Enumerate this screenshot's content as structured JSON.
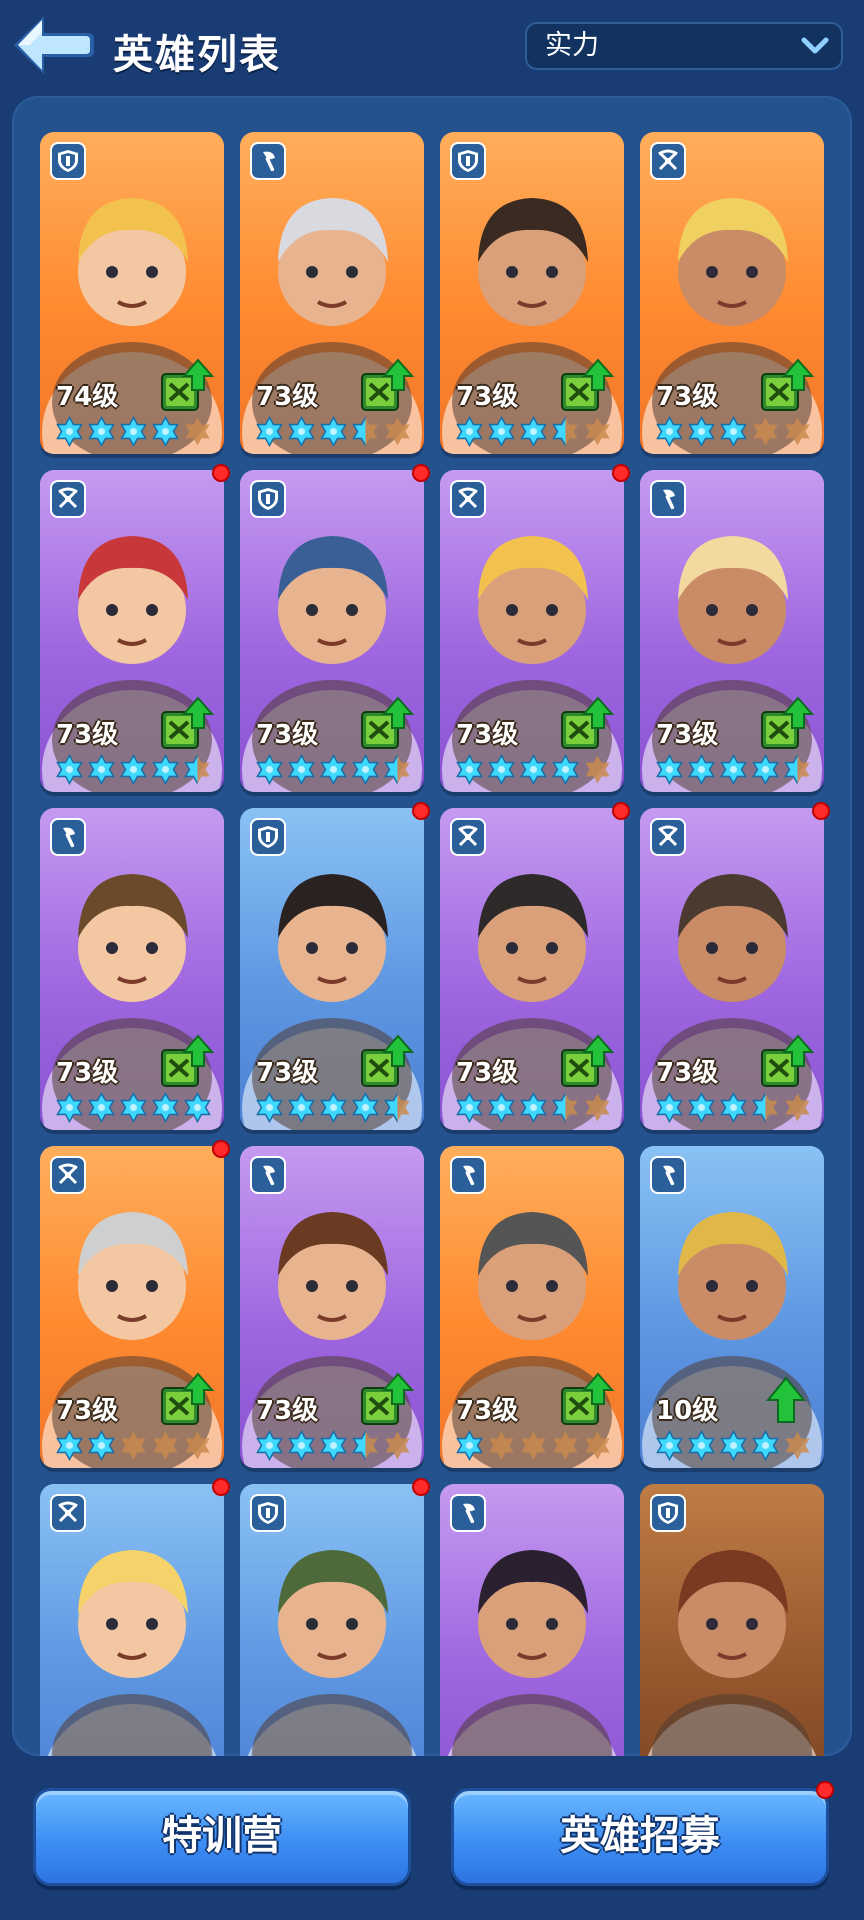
{
  "header": {
    "title": "英雄列表",
    "back_icon": "back-arrow-icon",
    "sort_select": {
      "selected": "实力",
      "icon": "chevron-down-icon"
    }
  },
  "colors": {
    "background": "#183c73",
    "panel": "#23528f",
    "star_filled": "#3fd8ff",
    "star_empty": "#c98a4d",
    "upgrade_arrow": "#22c33b",
    "red_dot": "#ff2a2a"
  },
  "heroes": [
    {
      "level": "74级",
      "rarity": "orange",
      "class_icon": "shield-icon",
      "stars": 4,
      "half": false,
      "dot": false,
      "upgrade": "book-upgrade-icon",
      "portrait": "girl-blonde-pigtails"
    },
    {
      "level": "73级",
      "rarity": "orange",
      "class_icon": "axe-icon",
      "stars": 3,
      "half": true,
      "dot": false,
      "upgrade": "book-upgrade-icon",
      "portrait": "girl-silver-hair-goggles"
    },
    {
      "level": "73级",
      "rarity": "orange",
      "class_icon": "shield-icon",
      "stars": 3,
      "half": true,
      "dot": false,
      "upgrade": "book-upgrade-icon",
      "portrait": "welder-mask-man"
    },
    {
      "level": "73级",
      "rarity": "orange",
      "class_icon": "crossbow-icon",
      "stars": 3,
      "half": false,
      "dot": false,
      "upgrade": "book-upgrade-icon",
      "portrait": "miner-helmet-old-man"
    },
    {
      "level": "73级",
      "rarity": "purple",
      "class_icon": "crossbow-icon",
      "stars": 4,
      "half": true,
      "dot": true,
      "upgrade": "book-upgrade-icon",
      "portrait": "red-haired-girl"
    },
    {
      "level": "73级",
      "rarity": "purple",
      "class_icon": "shield-icon",
      "stars": 4,
      "half": true,
      "dot": true,
      "upgrade": "book-upgrade-icon",
      "portrait": "officer-helmet-man"
    },
    {
      "level": "73级",
      "rarity": "purple",
      "class_icon": "crossbow-icon",
      "stars": 4,
      "half": false,
      "dot": true,
      "upgrade": "book-upgrade-icon",
      "portrait": "pilot-goggles-man"
    },
    {
      "level": "73级",
      "rarity": "purple",
      "class_icon": "axe-icon",
      "stars": 4,
      "half": true,
      "dot": false,
      "upgrade": "book-upgrade-icon",
      "portrait": "chef-beard-man"
    },
    {
      "level": "73级",
      "rarity": "purple",
      "class_icon": "axe-icon",
      "stars": 5,
      "half": false,
      "dot": false,
      "upgrade": "book-upgrade-icon",
      "portrait": "viking-goggles-man"
    },
    {
      "level": "73级",
      "rarity": "blue",
      "class_icon": "shield-icon",
      "stars": 4,
      "half": true,
      "dot": true,
      "upgrade": "book-upgrade-icon",
      "portrait": "bearded-goggles-man"
    },
    {
      "level": "73级",
      "rarity": "purple",
      "class_icon": "crossbow-icon",
      "stars": 3,
      "half": true,
      "dot": true,
      "upgrade": "book-upgrade-icon",
      "portrait": "dark-haired-girl"
    },
    {
      "level": "73级",
      "rarity": "purple",
      "class_icon": "crossbow-icon",
      "stars": 3,
      "half": true,
      "dot": true,
      "upgrade": "book-upgrade-icon",
      "portrait": "desert-scarf-man"
    },
    {
      "level": "73级",
      "rarity": "orange",
      "class_icon": "crossbow-icon",
      "stars": 2,
      "half": false,
      "dot": true,
      "upgrade": "book-upgrade-icon",
      "portrait": "old-gray-beard-man"
    },
    {
      "level": "73级",
      "rarity": "purple",
      "class_icon": "axe-icon",
      "stars": 3,
      "half": true,
      "dot": false,
      "upgrade": "book-upgrade-icon",
      "portrait": "headband-young-man"
    },
    {
      "level": "73级",
      "rarity": "orange",
      "class_icon": "axe-icon",
      "stars": 1,
      "half": false,
      "dot": false,
      "upgrade": "book-upgrade-icon",
      "portrait": "plague-mask-man"
    },
    {
      "level": "10级",
      "rarity": "blue",
      "class_icon": "axe-icon",
      "stars": 4,
      "half": false,
      "dot": false,
      "upgrade": "arrow-up-icon",
      "portrait": "mustache-cap-man"
    },
    {
      "level": "",
      "rarity": "blue",
      "class_icon": "crossbow-icon",
      "stars": 0,
      "half": false,
      "dot": true,
      "upgrade": "",
      "portrait": "blonde-woman"
    },
    {
      "level": "",
      "rarity": "blue",
      "class_icon": "shield-icon",
      "stars": 0,
      "half": false,
      "dot": true,
      "upgrade": "",
      "portrait": "fur-hat-bearded-man"
    },
    {
      "level": "",
      "rarity": "purple",
      "class_icon": "axe-icon",
      "stars": 0,
      "half": false,
      "dot": false,
      "upgrade": "book-upgrade-icon",
      "portrait": "ponytail-girl"
    },
    {
      "level": "",
      "rarity": "brown",
      "class_icon": "shield-icon",
      "stars": 0,
      "half": false,
      "dot": false,
      "upgrade": "",
      "portrait": "brown-haired-man"
    }
  ],
  "buttons": {
    "training_camp": "特训营",
    "recruit": "英雄招募",
    "recruit_has_dot": true
  }
}
